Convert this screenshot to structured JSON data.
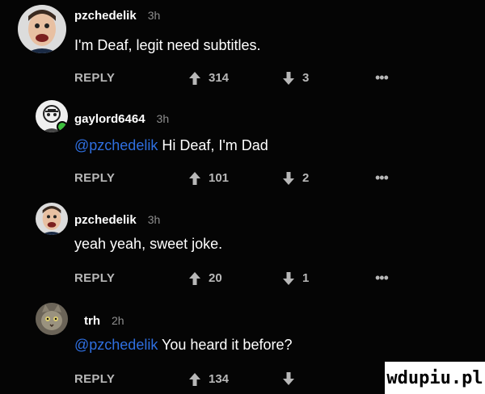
{
  "comments": [
    {
      "username": "pzchedelik",
      "time": "3h",
      "mention": "",
      "text": "I'm Deaf, legit need subtitles.",
      "reply_label": "REPLY",
      "upvotes": "314",
      "downvotes": "3",
      "more": "•••",
      "avatar_icon": "user-avatar-face-icon"
    },
    {
      "username": "gaylord6464",
      "time": "3h",
      "mention": "@pzchedelik",
      "text": "Hi Deaf, I'm Dad",
      "reply_label": "REPLY",
      "upvotes": "101",
      "downvotes": "2",
      "more": "•••",
      "avatar_icon": "user-avatar-sketch-icon"
    },
    {
      "username": "pzchedelik",
      "time": "3h",
      "mention": "",
      "text": "yeah yeah, sweet joke.",
      "reply_label": "REPLY",
      "upvotes": "20",
      "downvotes": "1",
      "more": "•••",
      "avatar_icon": "user-avatar-face-icon"
    },
    {
      "username": "trh",
      "time": "2h",
      "mention": "@pzchedelik",
      "text": "You heard it before?",
      "reply_label": "REPLY",
      "upvotes": "134",
      "downvotes": "",
      "more": "",
      "avatar_icon": "user-avatar-cat-icon"
    }
  ],
  "watermark": "wdupiu.pl",
  "colors": {
    "background": "#050505",
    "mention": "#2f6fe0",
    "muted": "#b8b8b8"
  }
}
